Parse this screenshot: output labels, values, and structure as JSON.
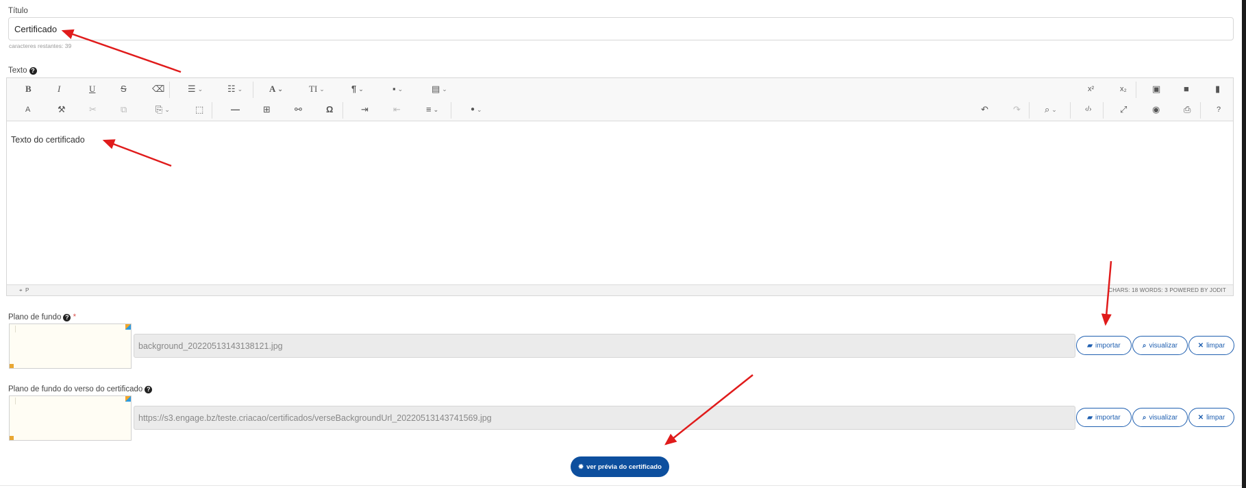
{
  "titulo": {
    "label": "Título",
    "value": "Certificado",
    "hint": "caracteres restantes: 39"
  },
  "texto": {
    "label": "Texto",
    "help_icon": "question-circle-icon"
  },
  "toolbar": {
    "row1_left": [
      {
        "name": "bold",
        "glyph": "B"
      },
      {
        "name": "italic",
        "glyph": "I"
      },
      {
        "name": "underline",
        "glyph": "U"
      },
      {
        "name": "strikethrough",
        "glyph": "S"
      },
      {
        "name": "eraser",
        "glyph": "⌫"
      },
      {
        "name": "unordered-list",
        "glyph": "☰"
      },
      {
        "name": "ordered-list",
        "glyph": "☷"
      },
      {
        "name": "font",
        "glyph": "A"
      },
      {
        "name": "font-size",
        "glyph": "TI"
      },
      {
        "name": "paragraph",
        "glyph": "¶"
      },
      {
        "name": "image-inline",
        "glyph": "▪"
      },
      {
        "name": "align-block",
        "glyph": "▤"
      }
    ],
    "row1_right": [
      {
        "name": "superscript",
        "glyph": "x²"
      },
      {
        "name": "subscript",
        "glyph": "x₂"
      },
      {
        "name": "image",
        "glyph": "▣"
      },
      {
        "name": "video",
        "glyph": "■"
      },
      {
        "name": "file",
        "glyph": "▮"
      }
    ],
    "row2_left": [
      {
        "name": "spellcheck",
        "glyph": "A"
      },
      {
        "name": "copy-format",
        "glyph": "⚒"
      },
      {
        "name": "cut",
        "glyph": "✂"
      },
      {
        "name": "copy",
        "glyph": "⧉"
      },
      {
        "name": "paste",
        "glyph": "⎘"
      },
      {
        "name": "select-all",
        "glyph": "⬚"
      },
      {
        "name": "horizontal-rule",
        "glyph": "—"
      },
      {
        "name": "table",
        "glyph": "⊞"
      },
      {
        "name": "link",
        "glyph": "⚯"
      },
      {
        "name": "symbol",
        "glyph": "Ω"
      },
      {
        "name": "indent",
        "glyph": "⇥"
      },
      {
        "name": "outdent",
        "glyph": "⇤"
      },
      {
        "name": "align",
        "glyph": "≡"
      },
      {
        "name": "brush",
        "glyph": "●"
      }
    ],
    "row2_right": [
      {
        "name": "undo",
        "glyph": "↶"
      },
      {
        "name": "redo",
        "glyph": "↷"
      },
      {
        "name": "find",
        "glyph": "⌕"
      },
      {
        "name": "source",
        "glyph": "‹/›"
      },
      {
        "name": "fullsize",
        "glyph": "⤢"
      },
      {
        "name": "preview",
        "glyph": "◉"
      },
      {
        "name": "print",
        "glyph": "⎙"
      },
      {
        "name": "about",
        "glyph": "?"
      }
    ]
  },
  "editor": {
    "content": "Texto do certificado",
    "status_left": "P",
    "status_right": "CHARS: 18   WORDS: 3   POWERED BY JODIT"
  },
  "background": {
    "label": "Plano de fundo",
    "required_mark": "*",
    "file_value": "background_20220513143138121.jpg"
  },
  "verse_background": {
    "label": "Plano de fundo do verso do certificado",
    "file_value": "https://s3.engage.bz/teste.criacao/certificados/verseBackgroundUrl_20220513143741569.jpg"
  },
  "buttons": {
    "importar": "importar",
    "visualizar": "visualizar",
    "limpar": "limpar",
    "preview": "ver prévia do certificado"
  },
  "annotations": {
    "arrow_color": "#e01b1b"
  },
  "colors": {
    "primary": "#0d4f9e",
    "outline": "#1f5fb0"
  }
}
